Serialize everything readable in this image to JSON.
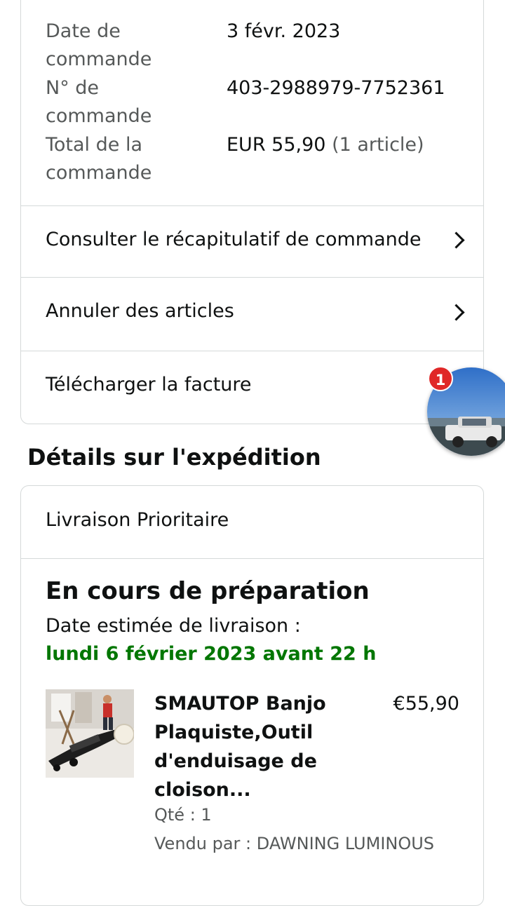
{
  "order_summary": {
    "order_date_label": "Date de commande",
    "order_date_value": "3 févr. 2023",
    "order_number_label": "N° de commande",
    "order_number_value": "403-2988979-7752361",
    "order_total_label": "Total de la commande",
    "order_total_value": "EUR 55,90",
    "order_total_count": "(1 article)"
  },
  "actions": {
    "view_summary": "Consulter le récapitulatif de commande",
    "cancel_items": "Annuler des articles",
    "download_invoice": "Télécharger la facture"
  },
  "shipping": {
    "section_title": "Détails sur l'expédition",
    "method": "Livraison Prioritaire",
    "status": "En cours de préparation",
    "estimated_label": "Date estimée de livraison :",
    "estimated_date": "lundi 6 février 2023 avant 22 h",
    "product": {
      "title": "SMAUTOP Banjo Plaquiste,Outil d'enduisage de cloison...",
      "price": "€55,90",
      "quantity": "Qté : 1",
      "seller": "Vendu par : DAWNING LUMINOUS"
    }
  },
  "chat_bubble": {
    "badge_count": "1"
  },
  "colors": {
    "delivery_green": "#007600",
    "badge_red": "#e02828",
    "border": "#d5d9d9"
  }
}
